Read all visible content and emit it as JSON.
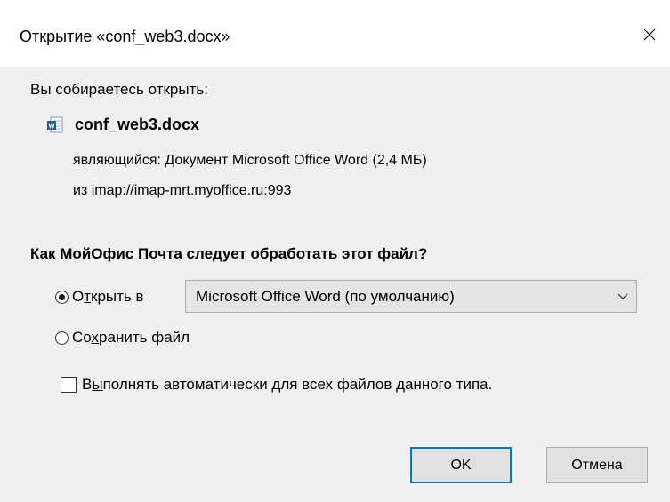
{
  "window": {
    "title": "Открытие «conf_web3.docx»"
  },
  "prompt": "Вы собираетесь открыть:",
  "file": {
    "name": "conf_web3.docx",
    "type_label": "являющийся:",
    "type_value": "Документ Microsoft Office Word (2,4 МБ)",
    "source_label": "из",
    "source_value": "imap://imap-mrt.myoffice.ru:993"
  },
  "question": "Как МойОфис Почта следует обработать этот файл?",
  "options": {
    "open_with": {
      "label_prefix": "О",
      "label_mnemonic": "т",
      "label_rest": "крыть в",
      "checked": true
    },
    "open_app_selected": "Microsoft Office Word (по умолчанию)",
    "save_file": {
      "label_prefix": "Со",
      "label_mnemonic": "х",
      "label_rest": "ранить файл",
      "checked": false
    },
    "auto": {
      "label_prefix": "В",
      "label_mnemonic": "ы",
      "label_rest": "полнять автоматически для всех файлов данного типа.",
      "checked": false
    }
  },
  "buttons": {
    "ok_label": "OK",
    "cancel_label": "Отмена"
  },
  "colors": {
    "dialog_bg": "#f0f0f0",
    "accent": "#0078d7",
    "word_icon": "#2b579a"
  },
  "icons": {
    "close": "close-icon",
    "document": "word-document-icon",
    "dropdown": "chevron-down-icon"
  }
}
